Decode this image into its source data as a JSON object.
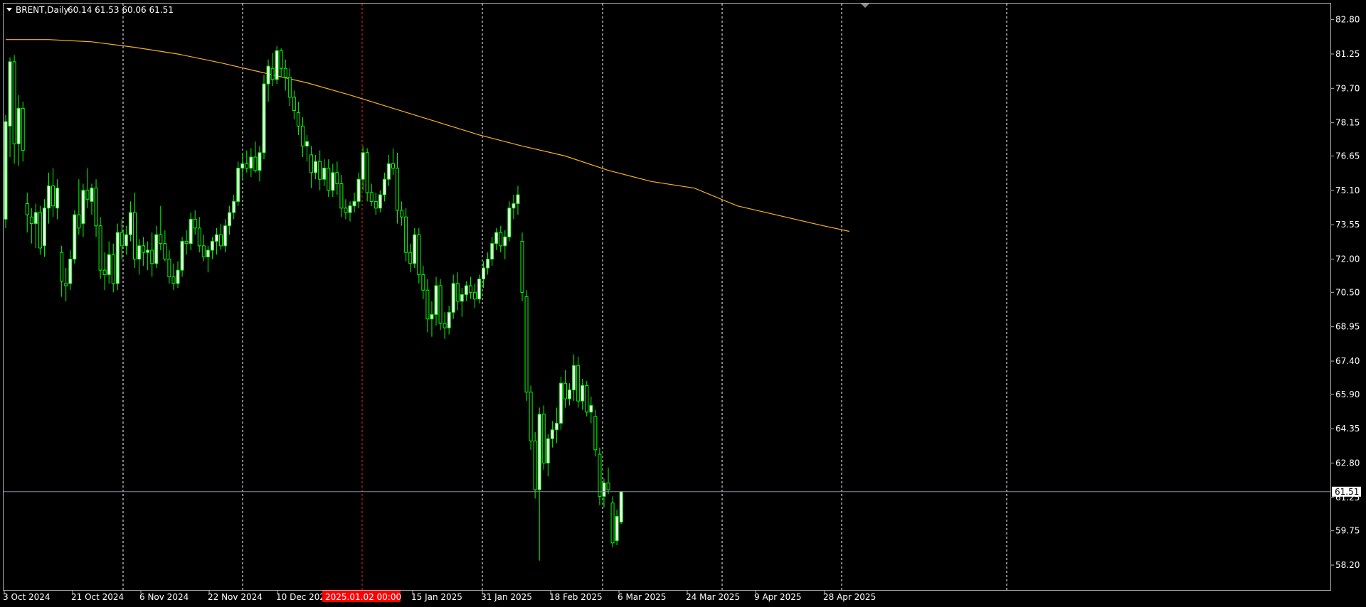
{
  "header": {
    "symbol": "BRENT,Daily",
    "ohlc": "60.14 61.53 60.06 61.51"
  },
  "colors": {
    "background": "#000000",
    "frame": "#b4b4b4",
    "bull_candle": "#00ff00",
    "bull_body": "#ffffff",
    "bear_candle": "#00ff00",
    "bear_body": "#000000",
    "grid": "#ffffff",
    "marker_line": "#ff2020",
    "ma_line": "#f5b418",
    "price_line": "#7f8fa0",
    "price_box_bg": "#ffffff",
    "price_box_fg": "#000000",
    "date_highlight_bg": "#ff0000"
  },
  "chart_data": {
    "type": "candlestick",
    "y_ticks": [
      "82.80",
      "81.25",
      "79.70",
      "78.15",
      "76.65",
      "75.10",
      "73.55",
      "72.00",
      "70.50",
      "68.95",
      "67.40",
      "65.90",
      "64.35",
      "62.80",
      "61.25",
      "59.75",
      "58.20"
    ],
    "ylim": [
      57.4,
      83.3
    ],
    "x_labels": [
      "3 Oct 2024",
      "21 Oct 2024",
      "6 Nov 2024",
      "22 Nov 2024",
      "10 Dec 2024",
      "15 Jan 2025",
      "31 Jan 2025",
      "18 Feb 2025",
      "6 Mar 2025",
      "24 Mar 2025",
      "9 Apr 2025",
      "28 Apr 2025"
    ],
    "highlighted_date": "2025.01.02 00:00",
    "current_price": "61.51",
    "moving_average": [
      {
        "d": 0,
        "v": 81.9
      },
      {
        "d": 10,
        "v": 81.9
      },
      {
        "d": 20,
        "v": 81.8
      },
      {
        "d": 30,
        "v": 81.55
      },
      {
        "d": 40,
        "v": 81.25
      },
      {
        "d": 50,
        "v": 80.85
      },
      {
        "d": 60,
        "v": 80.4
      },
      {
        "d": 70,
        "v": 79.95
      },
      {
        "d": 80,
        "v": 79.4
      },
      {
        "d": 90,
        "v": 78.8
      },
      {
        "d": 100,
        "v": 78.2
      },
      {
        "d": 110,
        "v": 77.6
      },
      {
        "d": 120,
        "v": 77.1
      },
      {
        "d": 130,
        "v": 76.65
      },
      {
        "d": 140,
        "v": 76.0
      },
      {
        "d": 150,
        "v": 75.5
      },
      {
        "d": 160,
        "v": 75.2
      },
      {
        "d": 170,
        "v": 74.4
      },
      {
        "d": 180,
        "v": 73.95
      },
      {
        "d": 190,
        "v": 73.5
      },
      {
        "d": 196,
        "v": 73.25
      }
    ],
    "candles": [
      {
        "o": 73.8,
        "h": 78.5,
        "l": 73.4,
        "c": 78.2
      },
      {
        "o": 78.0,
        "h": 81.1,
        "l": 76.6,
        "c": 80.9
      },
      {
        "o": 80.9,
        "h": 81.2,
        "l": 76.3,
        "c": 77.2
      },
      {
        "o": 77.2,
        "h": 79.4,
        "l": 76.2,
        "c": 78.8
      },
      {
        "o": 78.8,
        "h": 79.1,
        "l": 76.4,
        "c": 76.9
      },
      {
        "o": 74.5,
        "h": 75.0,
        "l": 73.2,
        "c": 74.0
      },
      {
        "o": 73.9,
        "h": 74.3,
        "l": 72.7,
        "c": 73.6
      },
      {
        "o": 73.6,
        "h": 74.5,
        "l": 72.5,
        "c": 74.1
      },
      {
        "o": 74.1,
        "h": 74.4,
        "l": 72.2,
        "c": 72.5
      },
      {
        "o": 72.6,
        "h": 74.7,
        "l": 72.1,
        "c": 74.3
      },
      {
        "o": 74.3,
        "h": 75.9,
        "l": 73.6,
        "c": 75.3
      },
      {
        "o": 75.3,
        "h": 76.1,
        "l": 73.9,
        "c": 74.4
      },
      {
        "o": 74.3,
        "h": 75.6,
        "l": 73.8,
        "c": 75.2
      },
      {
        "o": 72.3,
        "h": 72.6,
        "l": 70.3,
        "c": 71.0
      },
      {
        "o": 70.9,
        "h": 71.6,
        "l": 70.1,
        "c": 70.8
      },
      {
        "o": 70.9,
        "h": 72.4,
        "l": 70.6,
        "c": 72.0
      },
      {
        "o": 72.0,
        "h": 74.2,
        "l": 71.8,
        "c": 74.0
      },
      {
        "o": 74.0,
        "h": 75.6,
        "l": 73.1,
        "c": 73.4
      },
      {
        "o": 73.6,
        "h": 75.4,
        "l": 73.0,
        "c": 75.1
      },
      {
        "o": 75.1,
        "h": 76.1,
        "l": 74.3,
        "c": 74.7
      },
      {
        "o": 74.6,
        "h": 75.4,
        "l": 74.0,
        "c": 75.2
      },
      {
        "o": 75.2,
        "h": 75.6,
        "l": 73.0,
        "c": 73.5
      },
      {
        "o": 73.5,
        "h": 73.9,
        "l": 71.1,
        "c": 71.5
      },
      {
        "o": 71.5,
        "h": 72.3,
        "l": 70.6,
        "c": 71.3
      },
      {
        "o": 71.3,
        "h": 72.8,
        "l": 70.9,
        "c": 72.2
      },
      {
        "o": 72.2,
        "h": 72.7,
        "l": 70.5,
        "c": 70.9
      },
      {
        "o": 70.9,
        "h": 73.6,
        "l": 70.6,
        "c": 73.2
      },
      {
        "o": 73.2,
        "h": 73.8,
        "l": 72.0,
        "c": 72.6
      },
      {
        "o": 72.6,
        "h": 73.5,
        "l": 72.2,
        "c": 73.1
      },
      {
        "o": 73.1,
        "h": 74.6,
        "l": 72.8,
        "c": 74.1
      },
      {
        "o": 74.1,
        "h": 75.0,
        "l": 71.6,
        "c": 72.0
      },
      {
        "o": 72.0,
        "h": 72.9,
        "l": 71.3,
        "c": 72.6
      },
      {
        "o": 72.6,
        "h": 73.0,
        "l": 71.7,
        "c": 72.3
      },
      {
        "o": 72.3,
        "h": 72.8,
        "l": 71.5,
        "c": 72.4
      },
      {
        "o": 72.4,
        "h": 73.2,
        "l": 71.2,
        "c": 71.8
      },
      {
        "o": 71.8,
        "h": 73.5,
        "l": 71.6,
        "c": 73.1
      },
      {
        "o": 73.1,
        "h": 74.4,
        "l": 72.4,
        "c": 72.7
      },
      {
        "o": 72.7,
        "h": 73.3,
        "l": 71.9,
        "c": 72.0
      },
      {
        "o": 72.0,
        "h": 72.4,
        "l": 70.9,
        "c": 71.2
      },
      {
        "o": 71.2,
        "h": 71.8,
        "l": 70.6,
        "c": 70.9
      },
      {
        "o": 70.9,
        "h": 71.9,
        "l": 70.7,
        "c": 71.5
      },
      {
        "o": 71.5,
        "h": 73.0,
        "l": 71.2,
        "c": 72.8
      },
      {
        "o": 72.8,
        "h": 73.3,
        "l": 72.2,
        "c": 72.7
      },
      {
        "o": 72.7,
        "h": 74.1,
        "l": 72.4,
        "c": 73.8
      },
      {
        "o": 73.8,
        "h": 74.2,
        "l": 73.1,
        "c": 73.4
      },
      {
        "o": 73.4,
        "h": 73.9,
        "l": 72.3,
        "c": 72.6
      },
      {
        "o": 72.6,
        "h": 73.1,
        "l": 71.9,
        "c": 72.1
      },
      {
        "o": 72.1,
        "h": 72.6,
        "l": 71.4,
        "c": 72.4
      },
      {
        "o": 72.4,
        "h": 73.0,
        "l": 72.0,
        "c": 72.8
      },
      {
        "o": 72.8,
        "h": 73.4,
        "l": 72.2,
        "c": 73.1
      },
      {
        "o": 73.1,
        "h": 73.6,
        "l": 72.4,
        "c": 72.6
      },
      {
        "o": 72.6,
        "h": 73.8,
        "l": 72.3,
        "c": 73.5
      },
      {
        "o": 73.5,
        "h": 74.4,
        "l": 73.1,
        "c": 74.1
      },
      {
        "o": 74.1,
        "h": 74.9,
        "l": 73.8,
        "c": 74.6
      },
      {
        "o": 74.6,
        "h": 76.4,
        "l": 74.4,
        "c": 76.1
      },
      {
        "o": 76.1,
        "h": 76.8,
        "l": 75.6,
        "c": 76.3
      },
      {
        "o": 76.3,
        "h": 76.9,
        "l": 75.9,
        "c": 76.1
      },
      {
        "o": 76.1,
        "h": 77.0,
        "l": 75.7,
        "c": 76.6
      },
      {
        "o": 76.6,
        "h": 77.3,
        "l": 75.9,
        "c": 76.0
      },
      {
        "o": 76.0,
        "h": 77.1,
        "l": 75.5,
        "c": 76.8
      },
      {
        "o": 76.8,
        "h": 80.3,
        "l": 76.5,
        "c": 79.9
      },
      {
        "o": 79.9,
        "h": 81.0,
        "l": 79.1,
        "c": 80.7
      },
      {
        "o": 80.6,
        "h": 81.3,
        "l": 79.8,
        "c": 80.1
      },
      {
        "o": 80.1,
        "h": 81.6,
        "l": 79.9,
        "c": 81.4
      },
      {
        "o": 81.4,
        "h": 81.5,
        "l": 80.2,
        "c": 80.6
      },
      {
        "o": 80.6,
        "h": 81.0,
        "l": 79.6,
        "c": 80.2
      },
      {
        "o": 80.2,
        "h": 80.6,
        "l": 78.9,
        "c": 79.3
      },
      {
        "o": 79.3,
        "h": 79.6,
        "l": 78.3,
        "c": 78.7
      },
      {
        "o": 78.6,
        "h": 79.1,
        "l": 77.6,
        "c": 78.0
      },
      {
        "o": 78.0,
        "h": 78.4,
        "l": 76.6,
        "c": 77.1
      },
      {
        "o": 77.1,
        "h": 77.6,
        "l": 76.4,
        "c": 77.3
      },
      {
        "o": 76.7,
        "h": 77.1,
        "l": 75.2,
        "c": 75.9
      },
      {
        "o": 75.9,
        "h": 76.7,
        "l": 75.6,
        "c": 76.4
      },
      {
        "o": 76.4,
        "h": 76.9,
        "l": 75.1,
        "c": 75.6
      },
      {
        "o": 75.6,
        "h": 76.5,
        "l": 75.3,
        "c": 76.1
      },
      {
        "o": 76.1,
        "h": 76.5,
        "l": 74.8,
        "c": 75.1
      },
      {
        "o": 75.1,
        "h": 76.3,
        "l": 74.8,
        "c": 75.9
      },
      {
        "o": 75.9,
        "h": 76.4,
        "l": 74.9,
        "c": 75.4
      },
      {
        "o": 75.4,
        "h": 75.8,
        "l": 73.9,
        "c": 74.3
      },
      {
        "o": 74.3,
        "h": 74.7,
        "l": 73.8,
        "c": 74.1
      },
      {
        "o": 74.1,
        "h": 74.6,
        "l": 73.7,
        "c": 74.4
      },
      {
        "o": 74.4,
        "h": 75.0,
        "l": 74.1,
        "c": 74.6
      },
      {
        "o": 74.6,
        "h": 75.9,
        "l": 74.3,
        "c": 75.6
      },
      {
        "o": 75.6,
        "h": 77.1,
        "l": 75.1,
        "c": 76.8
      },
      {
        "o": 76.8,
        "h": 77.0,
        "l": 74.6,
        "c": 75.0
      },
      {
        "o": 75.0,
        "h": 75.4,
        "l": 74.4,
        "c": 74.6
      },
      {
        "o": 74.6,
        "h": 75.0,
        "l": 74.0,
        "c": 74.3
      },
      {
        "o": 74.3,
        "h": 75.1,
        "l": 74.1,
        "c": 74.9
      },
      {
        "o": 74.9,
        "h": 75.9,
        "l": 74.6,
        "c": 75.6
      },
      {
        "o": 75.6,
        "h": 76.7,
        "l": 75.3,
        "c": 76.3
      },
      {
        "o": 76.3,
        "h": 77.0,
        "l": 75.8,
        "c": 76.1
      },
      {
        "o": 76.1,
        "h": 76.8,
        "l": 73.6,
        "c": 74.2
      },
      {
        "o": 74.2,
        "h": 74.6,
        "l": 73.5,
        "c": 73.9
      },
      {
        "o": 73.9,
        "h": 74.3,
        "l": 71.9,
        "c": 72.3
      },
      {
        "o": 72.3,
        "h": 72.7,
        "l": 71.4,
        "c": 71.8
      },
      {
        "o": 71.8,
        "h": 73.4,
        "l": 71.6,
        "c": 73.1
      },
      {
        "o": 73.1,
        "h": 73.4,
        "l": 70.9,
        "c": 71.3
      },
      {
        "o": 71.3,
        "h": 71.7,
        "l": 70.2,
        "c": 70.6
      },
      {
        "o": 70.6,
        "h": 71.1,
        "l": 68.7,
        "c": 69.3
      },
      {
        "o": 69.3,
        "h": 70.1,
        "l": 68.5,
        "c": 69.5
      },
      {
        "o": 69.5,
        "h": 71.2,
        "l": 69.0,
        "c": 70.8
      },
      {
        "o": 70.8,
        "h": 71.1,
        "l": 68.8,
        "c": 69.1
      },
      {
        "o": 69.1,
        "h": 69.6,
        "l": 68.4,
        "c": 68.9
      },
      {
        "o": 68.9,
        "h": 69.9,
        "l": 68.6,
        "c": 69.6
      },
      {
        "o": 69.6,
        "h": 71.3,
        "l": 69.3,
        "c": 70.9
      },
      {
        "o": 70.9,
        "h": 71.4,
        "l": 69.7,
        "c": 70.1
      },
      {
        "o": 70.1,
        "h": 70.7,
        "l": 69.4,
        "c": 70.4
      },
      {
        "o": 70.4,
        "h": 71.0,
        "l": 70.1,
        "c": 70.8
      },
      {
        "o": 70.8,
        "h": 71.2,
        "l": 70.2,
        "c": 70.5
      },
      {
        "o": 70.5,
        "h": 70.9,
        "l": 69.8,
        "c": 70.2
      },
      {
        "o": 70.2,
        "h": 71.3,
        "l": 70.0,
        "c": 71.1
      },
      {
        "o": 71.1,
        "h": 71.9,
        "l": 70.7,
        "c": 71.6
      },
      {
        "o": 71.6,
        "h": 72.3,
        "l": 71.3,
        "c": 72.0
      },
      {
        "o": 72.0,
        "h": 73.0,
        "l": 71.7,
        "c": 72.7
      },
      {
        "o": 72.7,
        "h": 73.4,
        "l": 72.4,
        "c": 73.2
      },
      {
        "o": 73.2,
        "h": 73.5,
        "l": 72.3,
        "c": 72.6
      },
      {
        "o": 72.6,
        "h": 73.3,
        "l": 72.0,
        "c": 73.0
      },
      {
        "o": 73.0,
        "h": 74.6,
        "l": 72.8,
        "c": 74.3
      },
      {
        "o": 74.3,
        "h": 74.9,
        "l": 73.8,
        "c": 74.5
      },
      {
        "o": 74.5,
        "h": 75.3,
        "l": 74.0,
        "c": 74.9
      },
      {
        "o": 72.8,
        "h": 73.2,
        "l": 70.1,
        "c": 70.5
      },
      {
        "o": 70.3,
        "h": 70.6,
        "l": 65.6,
        "c": 66.0
      },
      {
        "o": 66.0,
        "h": 66.3,
        "l": 63.4,
        "c": 63.8
      },
      {
        "o": 63.8,
        "h": 64.2,
        "l": 61.2,
        "c": 61.6
      },
      {
        "o": 61.6,
        "h": 65.3,
        "l": 58.4,
        "c": 65.0
      },
      {
        "o": 65.0,
        "h": 65.4,
        "l": 62.5,
        "c": 62.8
      },
      {
        "o": 62.8,
        "h": 64.1,
        "l": 62.2,
        "c": 63.9
      },
      {
        "o": 63.9,
        "h": 64.7,
        "l": 63.5,
        "c": 64.3
      },
      {
        "o": 64.3,
        "h": 65.3,
        "l": 63.7,
        "c": 64.6
      },
      {
        "o": 64.6,
        "h": 66.7,
        "l": 64.3,
        "c": 66.4
      },
      {
        "o": 66.4,
        "h": 67.0,
        "l": 65.3,
        "c": 65.7
      },
      {
        "o": 65.7,
        "h": 66.4,
        "l": 65.4,
        "c": 66.1
      },
      {
        "o": 66.1,
        "h": 67.7,
        "l": 65.6,
        "c": 67.2
      },
      {
        "o": 67.2,
        "h": 67.6,
        "l": 65.3,
        "c": 65.6
      },
      {
        "o": 65.6,
        "h": 66.6,
        "l": 65.2,
        "c": 66.3
      },
      {
        "o": 66.3,
        "h": 66.5,
        "l": 64.9,
        "c": 65.1
      },
      {
        "o": 65.1,
        "h": 65.8,
        "l": 64.6,
        "c": 65.4
      },
      {
        "o": 64.9,
        "h": 65.2,
        "l": 63.1,
        "c": 63.4
      },
      {
        "o": 63.2,
        "h": 63.5,
        "l": 60.9,
        "c": 61.3
      },
      {
        "o": 61.3,
        "h": 62.1,
        "l": 60.8,
        "c": 61.9
      },
      {
        "o": 61.9,
        "h": 62.6,
        "l": 61.4,
        "c": 61.6
      },
      {
        "o": 61.0,
        "h": 61.3,
        "l": 59.0,
        "c": 59.2
      },
      {
        "o": 59.3,
        "h": 60.7,
        "l": 59.1,
        "c": 60.4
      },
      {
        "o": 60.14,
        "h": 61.53,
        "l": 60.06,
        "c": 61.51
      }
    ]
  }
}
